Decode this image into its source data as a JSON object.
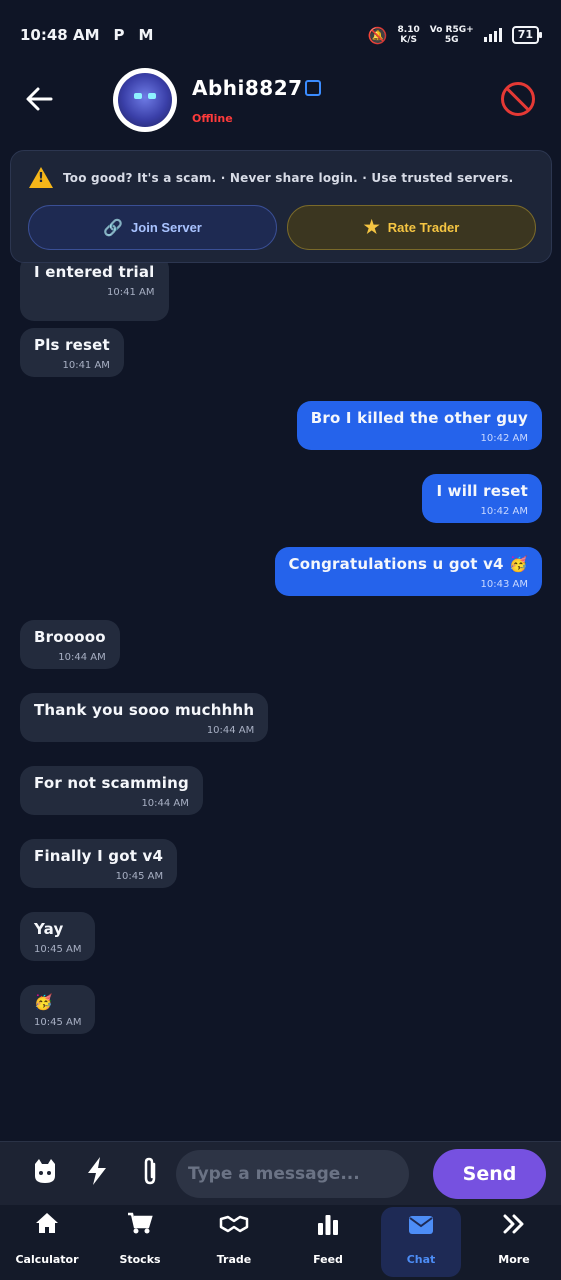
{
  "status_bar": {
    "time": "10:48 AM",
    "left_icons": [
      "P",
      "M"
    ],
    "net_speed_value": "8.10",
    "net_speed_unit": "K/S",
    "network_top": "Vo R5G+",
    "network_bottom": "5G",
    "battery": "71"
  },
  "header": {
    "back_icon": "arrow-left-icon",
    "username": "Abhi8827",
    "presence": "Offline",
    "presence_color": "#ff3b3b",
    "block_icon": "block-icon"
  },
  "warning": {
    "text": "Too good? It's a scam. · Never share login. · Use trusted servers.",
    "join_label": "Join Server",
    "rate_label": "Rate Trader"
  },
  "messages": [
    {
      "dir": "in",
      "text": "I entered trial",
      "time": "10:41 AM"
    },
    {
      "dir": "in",
      "text": "Pls reset",
      "time": "10:41 AM"
    },
    {
      "dir": "out",
      "text": "Bro I killed the other guy",
      "time": "10:42 AM"
    },
    {
      "dir": "out",
      "text": "I will reset",
      "time": "10:42 AM"
    },
    {
      "dir": "out",
      "text": "Congratulations u got v4 🥳",
      "time": "10:43 AM"
    },
    {
      "dir": "in",
      "text": "Brooooo",
      "time": "10:44 AM"
    },
    {
      "dir": "in",
      "text": "Thank you sooo muchhhh",
      "time": "10:44 AM"
    },
    {
      "dir": "in",
      "text": "For not scamming",
      "time": "10:44 AM"
    },
    {
      "dir": "in",
      "text": "Finally I got v4",
      "time": "10:45 AM"
    },
    {
      "dir": "in",
      "text": "Yay",
      "time": "10:45 AM"
    },
    {
      "dir": "in",
      "text": "🥳",
      "time": "10:45 AM"
    }
  ],
  "composer": {
    "placeholder": "Type a message...",
    "send_label": "Send",
    "tools": [
      "github-icon",
      "lightning-icon",
      "paperclip-icon"
    ]
  },
  "nav": [
    {
      "label": "Calculator",
      "icon": "home-icon",
      "active": false
    },
    {
      "label": "Stocks",
      "icon": "cart-icon",
      "active": false
    },
    {
      "label": "Trade",
      "icon": "handshake-icon",
      "active": false
    },
    {
      "label": "Feed",
      "icon": "bar-chart-icon",
      "active": false
    },
    {
      "label": "Chat",
      "icon": "mail-icon",
      "active": true
    },
    {
      "label": "More",
      "icon": "double-chevron-icon",
      "active": false
    }
  ],
  "colors": {
    "background": "#0f1526",
    "incoming_bubble": "#232b3d",
    "outgoing_bubble": "#2563eb",
    "send_button": "#7651e0",
    "active_nav": "#4d8df6"
  }
}
